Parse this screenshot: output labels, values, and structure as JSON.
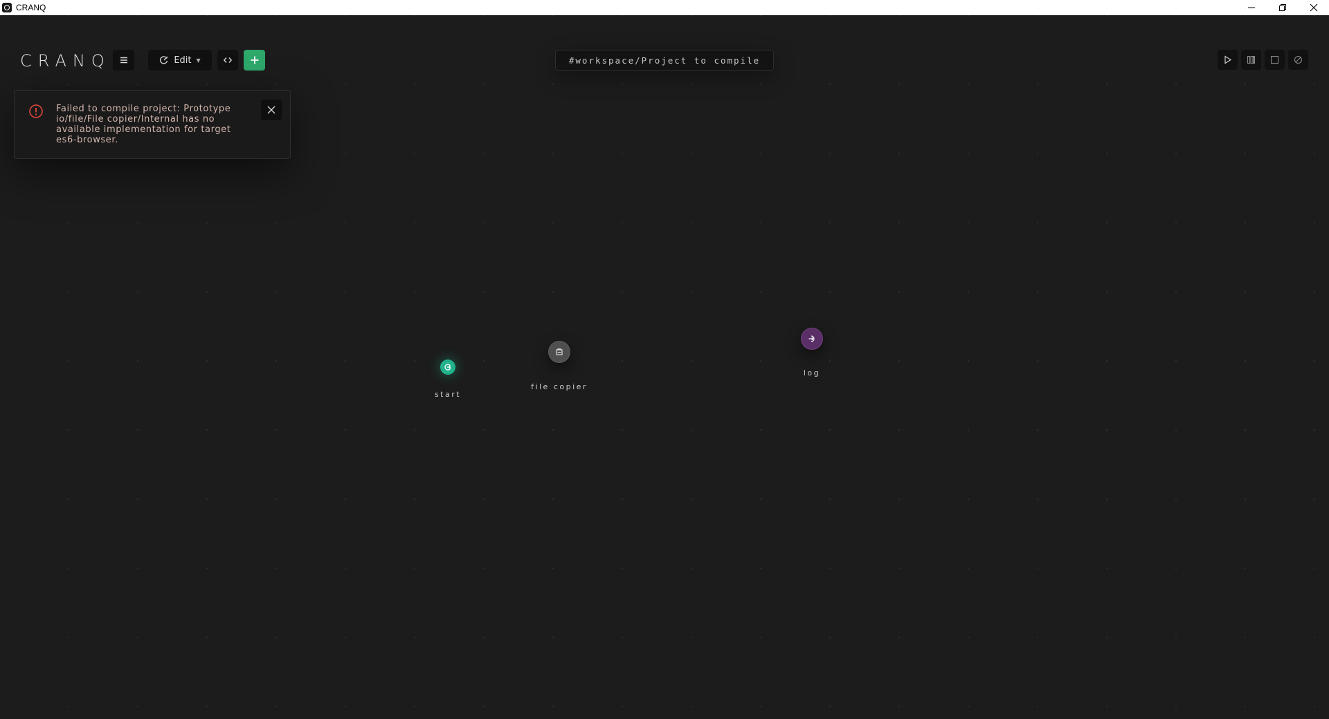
{
  "window": {
    "title": "CRANQ",
    "controls": [
      "minimize-icon",
      "restore-icon",
      "close-icon"
    ]
  },
  "toolbar": {
    "logo": "CRANQ",
    "menu_icon": "hamburger-menu-icon",
    "mode_label": "Edit",
    "mode_icon": "edit-mode-icon",
    "code_icon": "code-icon",
    "add_icon": "plus-icon",
    "add_color": "#2ea86b"
  },
  "project_path": "#workspace/Project to compile",
  "run_controls": [
    {
      "name": "run-button",
      "icon": "play-icon"
    },
    {
      "name": "pause-button",
      "icon": "pause-icon"
    },
    {
      "name": "stop-button",
      "icon": "stop-icon"
    },
    {
      "name": "clear-button",
      "icon": "cancel-icon"
    }
  ],
  "toast": {
    "icon": "error-icon",
    "icon_color": "#e0473c",
    "message": "Failed to compile project: Prototype io/file/File copier/Internal has no available implementation for target es6-browser.",
    "close_icon": "close-icon"
  },
  "nodes": [
    {
      "id": "start",
      "label": "start",
      "icon": "start-icon",
      "color": "#21b28c"
    },
    {
      "id": "file-copier",
      "label": "file copier",
      "icon": "folder-icon",
      "color": "#4f4f4f"
    },
    {
      "id": "log",
      "label": "log",
      "icon": "log-input-icon",
      "color": "#5a2f68"
    }
  ]
}
